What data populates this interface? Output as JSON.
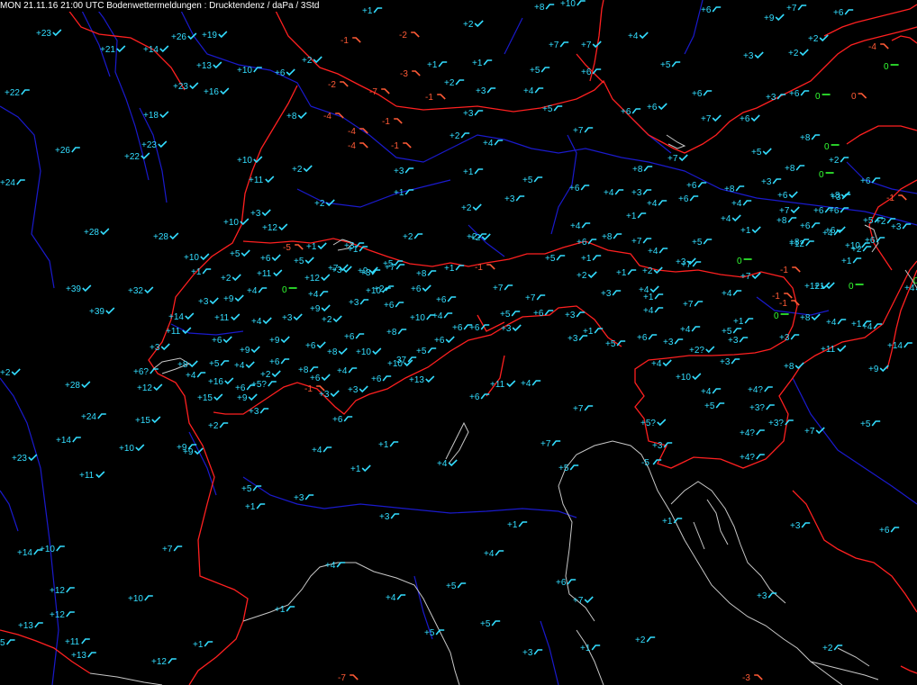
{
  "title": "MON 21.11.16 21:00 UTC  Bodenwettermeldungen :  Drucktendenz / daPa / 3Std",
  "colors": {
    "background": "#000000",
    "border": "#ff2020",
    "river": "#1a1acc",
    "coast": "#c8c8c8",
    "rising": "#33ddff",
    "falling": "#ff5a36",
    "steady": "#33ff33"
  },
  "station_reports": [
    {
      "v": "+1",
      "t": "rs"
    },
    {
      "v": "+8",
      "t": "rs"
    },
    {
      "v": "+10",
      "t": "rs"
    },
    {
      "v": "+6",
      "t": "rs"
    },
    {
      "v": "+7",
      "t": "rs"
    },
    {
      "v": "+6",
      "t": "rs"
    },
    {
      "v": "+23",
      "t": "rc"
    },
    {
      "v": "+26",
      "t": "rc"
    },
    {
      "v": "+19",
      "t": "rc"
    },
    {
      "v": "+2",
      "t": "rc"
    },
    {
      "v": "-1",
      "t": "fa"
    },
    {
      "v": "-2",
      "t": "fa"
    },
    {
      "v": "+7",
      "t": "rs"
    },
    {
      "v": "+7",
      "t": "rc"
    },
    {
      "v": "+4",
      "t": "rc"
    },
    {
      "v": "+9",
      "t": "rc"
    },
    {
      "v": "+2",
      "t": "rc"
    },
    {
      "v": "-4",
      "t": "fa"
    },
    {
      "v": "+21",
      "t": "rc"
    },
    {
      "v": "+14",
      "t": "rc"
    },
    {
      "v": "+13",
      "t": "rc"
    },
    {
      "v": "+10",
      "t": "rs"
    },
    {
      "v": "+6",
      "t": "rc"
    },
    {
      "v": "+2",
      "t": "rc"
    },
    {
      "v": "-3",
      "t": "fa"
    },
    {
      "v": "+1",
      "t": "rs"
    },
    {
      "v": "+1",
      "t": "rs"
    },
    {
      "v": "+5",
      "t": "rs"
    },
    {
      "v": "+6",
      "t": "rs"
    },
    {
      "v": "+5",
      "t": "rs"
    },
    {
      "v": "+3",
      "t": "rc"
    },
    {
      "v": "+2",
      "t": "rc"
    },
    {
      "v": "0",
      "t": "st"
    },
    {
      "v": "+23",
      "t": "rc"
    },
    {
      "v": "+16",
      "t": "rc"
    },
    {
      "v": "-2",
      "t": "fa"
    },
    {
      "v": "-7",
      "t": "fa"
    },
    {
      "v": "+2",
      "t": "rs"
    },
    {
      "v": "-1",
      "t": "fa"
    },
    {
      "v": "+3",
      "t": "rs"
    },
    {
      "v": "+4",
      "t": "rs"
    },
    {
      "v": "+6",
      "t": "rc"
    },
    {
      "v": "+3",
      "t": "rs"
    },
    {
      "v": "0",
      "t": "st"
    },
    {
      "v": "0",
      "t": "fa"
    },
    {
      "v": "+22",
      "t": "rs"
    },
    {
      "v": "+18",
      "t": "rc"
    },
    {
      "v": "+8",
      "t": "rc"
    },
    {
      "v": "-4",
      "t": "fa"
    },
    {
      "v": "-1",
      "t": "fa"
    },
    {
      "v": "+3",
      "t": "rs"
    },
    {
      "v": "+5",
      "t": "rs"
    },
    {
      "v": "+6",
      "t": "rs"
    },
    {
      "v": "+7",
      "t": "rc"
    },
    {
      "v": "+6",
      "t": "rc"
    },
    {
      "v": "+6",
      "t": "rs"
    },
    {
      "v": "+7",
      "t": "rs"
    },
    {
      "v": "-4",
      "t": "fa"
    },
    {
      "v": "+2",
      "t": "rs"
    },
    {
      "v": "+4",
      "t": "rs"
    },
    {
      "v": "+8",
      "t": "rs"
    },
    {
      "v": "+26",
      "t": "rs"
    },
    {
      "v": "+23",
      "t": "rc"
    },
    {
      "v": "-4",
      "t": "fa"
    },
    {
      "v": "-1",
      "t": "fa"
    },
    {
      "v": "+22",
      "t": "rc"
    },
    {
      "v": "+7",
      "t": "rc"
    },
    {
      "v": "+5",
      "t": "rc"
    },
    {
      "v": "+8",
      "t": "rs"
    },
    {
      "v": "+6",
      "t": "rs"
    },
    {
      "v": "+2",
      "t": "rs"
    },
    {
      "v": "0",
      "t": "st"
    },
    {
      "v": "+10",
      "t": "rc"
    },
    {
      "v": "+2",
      "t": "rc"
    },
    {
      "v": "+3",
      "t": "rs"
    },
    {
      "v": "+1",
      "t": "rs"
    },
    {
      "v": "+8",
      "t": "rs"
    },
    {
      "v": "+3",
      "t": "rs"
    },
    {
      "v": "+8",
      "t": "rs"
    },
    {
      "v": "0",
      "t": "st"
    },
    {
      "v": "+24",
      "t": "rs"
    },
    {
      "v": "+11",
      "t": "rc"
    },
    {
      "v": "+5",
      "t": "rs"
    },
    {
      "v": "+3",
      "t": "rs"
    },
    {
      "v": "+6",
      "t": "rs"
    },
    {
      "v": "+1",
      "t": "rs"
    },
    {
      "v": "+2",
      "t": "rc"
    },
    {
      "v": "+2",
      "t": "rc"
    },
    {
      "v": "+4",
      "t": "rs"
    },
    {
      "v": "+3",
      "t": "rs"
    },
    {
      "v": "+4",
      "t": "rs"
    },
    {
      "v": "+6",
      "t": "rs"
    },
    {
      "v": "+4",
      "t": "rc"
    },
    {
      "v": "+4",
      "t": "rs"
    },
    {
      "v": "+6",
      "t": "rc"
    },
    {
      "v": "+8",
      "t": "rc"
    },
    {
      "v": "+6",
      "t": "rs"
    },
    {
      "v": "+1",
      "t": "rs"
    },
    {
      "v": "-1",
      "t": "fa"
    },
    {
      "v": "+3",
      "t": "rc"
    },
    {
      "v": "+10",
      "t": "rc"
    },
    {
      "v": "+7",
      "t": "rc"
    },
    {
      "v": "+6",
      "t": "rs"
    },
    {
      "v": "+6",
      "t": "rs"
    },
    {
      "v": "+1",
      "t": "rc"
    },
    {
      "v": "+12",
      "t": "rc"
    },
    {
      "v": "+4",
      "t": "rs"
    },
    {
      "v": "+8",
      "t": "rs"
    },
    {
      "v": "+7",
      "t": "rs"
    },
    {
      "v": "+5",
      "t": "rs"
    },
    {
      "v": "+6",
      "t": "rs"
    },
    {
      "v": "+5",
      "t": "rs"
    },
    {
      "v": "+3",
      "t": "rs"
    },
    {
      "v": "+2",
      "t": "rs"
    },
    {
      "v": "+2",
      "t": "rs"
    },
    {
      "v": "+28",
      "t": "rc"
    },
    {
      "v": "+28",
      "t": "rc"
    },
    {
      "v": "+6",
      "t": "rc"
    },
    {
      "v": "+3",
      "t": "rs"
    },
    {
      "v": "+2",
      "t": "rs"
    },
    {
      "v": "+4",
      "t": "rs"
    },
    {
      "v": "+1",
      "t": "rc"
    },
    {
      "v": "+1",
      "t": "rs"
    },
    {
      "v": "+2",
      "t": "rc"
    },
    {
      "v": "+8",
      "t": "rs"
    },
    {
      "v": "+7",
      "t": "rs"
    },
    {
      "v": "+10",
      "t": "rc"
    },
    {
      "v": "+5",
      "t": "rc"
    },
    {
      "v": "+6",
      "t": "rc"
    },
    {
      "v": "+5",
      "t": "rc"
    },
    {
      "v": "-5",
      "t": "fa"
    },
    {
      "v": "0",
      "t": "st"
    },
    {
      "v": "+12",
      "t": "rs"
    },
    {
      "v": "+10",
      "t": "rs"
    },
    {
      "v": "+6",
      "t": "rs"
    },
    {
      "v": "+1",
      "t": "rs"
    },
    {
      "v": "+2",
      "t": "rc"
    },
    {
      "v": "+11",
      "t": "rc"
    },
    {
      "v": "+7",
      "t": "rc"
    },
    {
      "v": "+7",
      "t": "rs"
    },
    {
      "v": "+8",
      "t": "rs"
    },
    {
      "v": "+5",
      "t": "rs"
    },
    {
      "v": "+1",
      "t": "rs"
    },
    {
      "v": "-1",
      "t": "fa"
    },
    {
      "v": "+1",
      "t": "rs"
    },
    {
      "v": "+12",
      "t": "rc"
    },
    {
      "v": "+9",
      "t": "rc"
    },
    {
      "v": "+5",
      "t": "rs"
    },
    {
      "v": "+1",
      "t": "rs"
    },
    {
      "v": "-1",
      "t": "fa"
    },
    {
      "v": "+2",
      "t": "rc"
    },
    {
      "v": "+1",
      "t": "rs"
    },
    {
      "v": "+2",
      "t": "rc"
    },
    {
      "v": "+3",
      "t": "rc"
    },
    {
      "v": "+7",
      "t": "rc"
    },
    {
      "v": "+3",
      "t": "rc"
    },
    {
      "v": "+3",
      "t": "rs"
    },
    {
      "v": "+1",
      "t": "rs"
    },
    {
      "v": "+1",
      "t": "rc"
    },
    {
      "v": "+39",
      "t": "rc"
    },
    {
      "v": "+32",
      "t": "rc"
    },
    {
      "v": "+4",
      "t": "rs"
    },
    {
      "v": "0",
      "t": "st"
    },
    {
      "v": "+4",
      "t": "rs"
    },
    {
      "v": "+2",
      "t": "rs"
    },
    {
      "v": "+6",
      "t": "rc"
    },
    {
      "v": "+6",
      "t": "rs"
    },
    {
      "v": "+7",
      "t": "rs"
    },
    {
      "v": "+3",
      "t": "rs"
    },
    {
      "v": "+4",
      "t": "rc"
    },
    {
      "v": "+4",
      "t": "rs"
    },
    {
      "v": "-1",
      "t": "fa"
    },
    {
      "v": "0",
      "t": "st"
    },
    {
      "v": "+12",
      "t": "rc"
    },
    {
      "v": "+9",
      "t": "rc"
    },
    {
      "v": "+3",
      "t": "rc"
    },
    {
      "v": "+3",
      "t": "rs"
    },
    {
      "v": "+9",
      "t": "rc"
    },
    {
      "v": "+6",
      "t": "rs"
    },
    {
      "v": "+7",
      "t": "rs"
    },
    {
      "v": "+3",
      "t": "rs"
    },
    {
      "v": "+4",
      "t": "rs"
    },
    {
      "v": "+7",
      "t": "rs"
    },
    {
      "v": "+8",
      "t": "rc"
    },
    {
      "v": "+4",
      "t": "rs"
    },
    {
      "v": "+1",
      "t": "rs"
    },
    {
      "v": "0",
      "t": "st"
    },
    {
      "v": "+39",
      "t": "rc"
    },
    {
      "v": "+14",
      "t": "rc"
    },
    {
      "v": "+11",
      "t": "rc"
    },
    {
      "v": "+4",
      "t": "rc"
    },
    {
      "v": "+3",
      "t": "rc"
    },
    {
      "v": "+2",
      "t": "rc"
    },
    {
      "v": "+10",
      "t": "rs"
    },
    {
      "v": "+4",
      "t": "rs"
    },
    {
      "v": "+5",
      "t": "rs"
    },
    {
      "v": "+6",
      "t": "rs"
    },
    {
      "v": "+3",
      "t": "rs"
    },
    {
      "v": "+1",
      "t": "rs"
    },
    {
      "v": "0",
      "t": "st"
    },
    {
      "v": "+1",
      "t": "rs"
    },
    {
      "v": "+4",
      "t": "rs"
    },
    {
      "v": "+10",
      "t": "rs"
    },
    {
      "v": "+9",
      "t": "rc"
    },
    {
      "v": "+6",
      "t": "rs"
    },
    {
      "v": "+8",
      "t": "rs"
    },
    {
      "v": "+6",
      "t": "rs"
    },
    {
      "v": "+3",
      "t": "rc"
    },
    {
      "v": "+6",
      "t": "rc"
    },
    {
      "v": "+4",
      "t": "rs"
    },
    {
      "v": "+5",
      "t": "rs"
    },
    {
      "v": "+5",
      "t": "rs"
    },
    {
      "v": "+6",
      "t": "rs"
    },
    {
      "v": "+3",
      "t": "rs"
    },
    {
      "v": "+2?",
      "t": "rc"
    },
    {
      "v": "+3",
      "t": "rs"
    },
    {
      "v": "+14",
      "t": "rs"
    },
    {
      "v": "+11",
      "t": "rc"
    },
    {
      "v": "+3",
      "t": "rc"
    },
    {
      "v": "+11",
      "t": "rc"
    },
    {
      "v": "+6",
      "t": "rc"
    },
    {
      "v": "+9",
      "t": "rc"
    },
    {
      "v": "+10",
      "t": "rc"
    },
    {
      "v": "+5",
      "t": "rs"
    },
    {
      "v": "+6",
      "t": "rs"
    },
    {
      "v": "+3",
      "t": "rs"
    },
    {
      "v": "+5",
      "t": "rs"
    },
    {
      "v": "+6",
      "t": "rs"
    },
    {
      "v": "+8",
      "t": "rc"
    },
    {
      "v": "+4",
      "t": "rc"
    },
    {
      "v": "+10",
      "t": "rc"
    },
    {
      "v": "+6",
      "t": "rc"
    },
    {
      "v": "+11",
      "t": "rc"
    },
    {
      "v": "+9",
      "t": "rc"
    },
    {
      "v": "+2",
      "t": "rc"
    },
    {
      "v": "+6",
      "t": "rs"
    },
    {
      "v": "+6?",
      "t": "rs"
    },
    {
      "v": "+8",
      "t": "rs"
    },
    {
      "v": "+4",
      "t": "rs"
    },
    {
      "v": "+6",
      "t": "rs"
    },
    {
      "v": "37",
      "t": "rs"
    },
    {
      "v": "+13",
      "t": "rc"
    },
    {
      "v": "+10",
      "t": "rc"
    },
    {
      "v": "+8",
      "t": "rc"
    },
    {
      "v": "+2",
      "t": "rc"
    },
    {
      "v": "+4",
      "t": "rs"
    },
    {
      "v": "+8",
      "t": "rc"
    },
    {
      "v": "+6",
      "t": "rc"
    },
    {
      "v": "+5?",
      "t": "rs"
    },
    {
      "v": "+28",
      "t": "rc"
    },
    {
      "v": "+12",
      "t": "rc"
    },
    {
      "v": "+16",
      "t": "rc"
    },
    {
      "v": "+3",
      "t": "rc"
    },
    {
      "v": "-1",
      "t": "fa"
    },
    {
      "v": "+3",
      "t": "rc"
    },
    {
      "v": "+4",
      "t": "rc"
    },
    {
      "v": "+6",
      "t": "rs"
    },
    {
      "v": "+4",
      "t": "rs"
    },
    {
      "v": "+4",
      "t": "rs"
    },
    {
      "v": "+4?",
      "t": "rs"
    },
    {
      "v": "+15",
      "t": "rc"
    },
    {
      "v": "+9",
      "t": "rc"
    },
    {
      "v": "+5",
      "t": "rs"
    },
    {
      "v": "+3?",
      "t": "rs"
    },
    {
      "v": "+3",
      "t": "rs"
    },
    {
      "v": "+7",
      "t": "rs"
    },
    {
      "v": "+5",
      "t": "rs"
    },
    {
      "v": "+24",
      "t": "rs"
    },
    {
      "v": "+15",
      "t": "rc"
    },
    {
      "v": "+2",
      "t": "rs"
    },
    {
      "v": "+6",
      "t": "rs"
    },
    {
      "v": "+5?",
      "t": "rc"
    },
    {
      "v": "+3?",
      "t": "rs"
    },
    {
      "v": "+7",
      "t": "rc"
    },
    {
      "v": "+4?",
      "t": "rs"
    },
    {
      "v": "+14",
      "t": "rs"
    },
    {
      "v": "+10",
      "t": "rc"
    },
    {
      "v": "+9",
      "t": "rc"
    },
    {
      "v": "+4",
      "t": "rs"
    },
    {
      "v": "+1",
      "t": "rs"
    },
    {
      "v": "+7",
      "t": "rs"
    },
    {
      "v": "+3",
      "t": "rs"
    },
    {
      "v": "+4?",
      "t": "rs"
    },
    {
      "v": "+23",
      "t": "rc"
    },
    {
      "v": "+4",
      "t": "rc"
    },
    {
      "v": "+5",
      "t": "rs"
    },
    {
      "v": "-5",
      "t": "rs"
    },
    {
      "v": "+11",
      "t": "rc"
    },
    {
      "v": "+1",
      "t": "rc"
    },
    {
      "v": "+5",
      "t": "rs"
    },
    {
      "v": "+3",
      "t": "rs"
    },
    {
      "v": "+1",
      "t": "rs"
    },
    {
      "v": "+3",
      "t": "rs"
    },
    {
      "v": "+1",
      "t": "rs"
    },
    {
      "v": "+1",
      "t": "rs"
    },
    {
      "v": "+3",
      "t": "rs"
    },
    {
      "v": "+6",
      "t": "rs"
    },
    {
      "v": "+14",
      "t": "rs"
    },
    {
      "v": "+10",
      "t": "rs"
    },
    {
      "v": "+7",
      "t": "rs"
    },
    {
      "v": "+4",
      "t": "rs"
    },
    {
      "v": "+4",
      "t": "rs"
    },
    {
      "v": "+12",
      "t": "rs"
    },
    {
      "v": "+10",
      "t": "rs"
    },
    {
      "v": "+6",
      "t": "rs"
    },
    {
      "v": "+5",
      "t": "rs"
    },
    {
      "v": "+4",
      "t": "rs"
    },
    {
      "v": "+7",
      "t": "rc"
    },
    {
      "v": "+3",
      "t": "rs"
    },
    {
      "v": "+12",
      "t": "rs"
    },
    {
      "v": "+1",
      "t": "rs"
    },
    {
      "v": "+13",
      "t": "rs"
    },
    {
      "v": "+5",
      "t": "rs"
    },
    {
      "v": "+5",
      "t": "rs"
    },
    {
      "v": "5",
      "t": "rs"
    },
    {
      "v": "+11",
      "t": "rs"
    },
    {
      "v": "+13",
      "t": "rs"
    },
    {
      "v": "+1",
      "t": "rs"
    },
    {
      "v": "+3",
      "t": "rs"
    },
    {
      "v": "+1",
      "t": "rs"
    },
    {
      "v": "+2",
      "t": "rs"
    },
    {
      "v": "+2",
      "t": "rs"
    },
    {
      "v": "+12",
      "t": "rs"
    },
    {
      "v": "-7",
      "t": "fa"
    },
    {
      "v": "-3",
      "t": "fa"
    },
    {
      "v": "+6",
      "t": "rs"
    },
    {
      "v": "+4",
      "t": "rs"
    },
    {
      "v": "+9",
      "t": "rs"
    },
    {
      "v": "+6",
      "t": "rs"
    },
    {
      "v": "+3",
      "t": "rs"
    },
    {
      "v": "+4",
      "t": "rs"
    },
    {
      "v": "+3",
      "t": "rs"
    },
    {
      "v": "+8",
      "t": "rs"
    },
    {
      "v": "-1",
      "t": "fa"
    },
    {
      "v": "+2",
      "t": "rs"
    }
  ]
}
